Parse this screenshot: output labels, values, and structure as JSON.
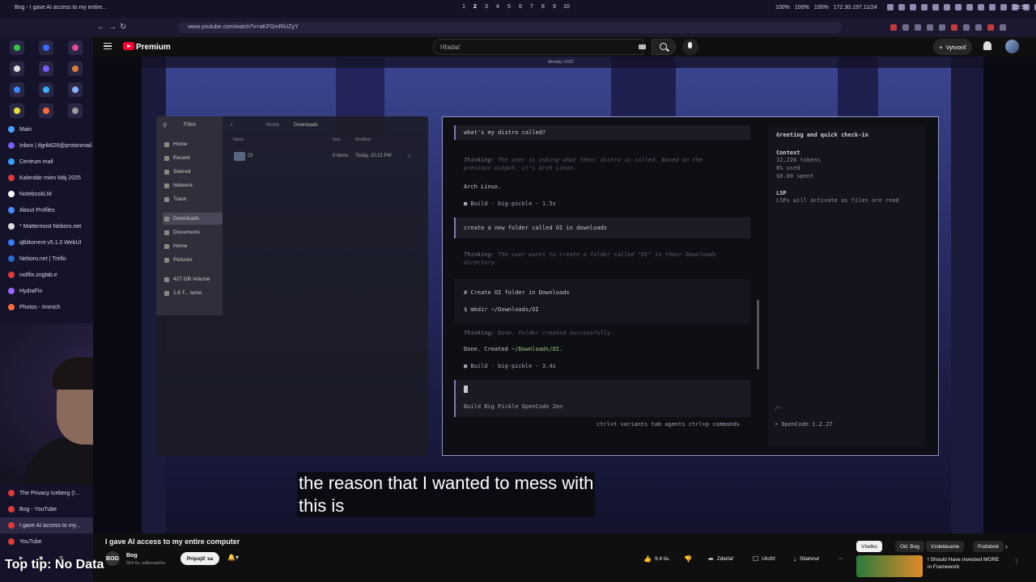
{
  "os": {
    "window_title": "Bog - I gave AI access to my entire...",
    "workspaces": [
      "1",
      "2",
      "3",
      "4",
      "5",
      "6",
      "7",
      "8",
      "9",
      "10"
    ],
    "active_workspace": "2",
    "stats": [
      "100%",
      "100%",
      "100%",
      "172.30.197.11/24"
    ],
    "clock": "23:58"
  },
  "browser": {
    "url": "www.youtube.com/watch?v=aKFGmRiUZyY"
  },
  "sidebar": {
    "items": [
      {
        "label": "Main",
        "color": "#4aa3ff"
      },
      {
        "label": "Inbox | tlgrik626@protonmail...",
        "color": "#7b5cff"
      },
      {
        "label": "Centrum mail",
        "color": "#3aa0ff"
      },
      {
        "label": "Kalendár mien Máj 2025",
        "color": "#e03a3a"
      },
      {
        "label": "NotebookLM",
        "color": "#ffffff"
      },
      {
        "label": "About Profiles",
        "color": "#4a8aff"
      },
      {
        "label": "* Mattermost Neboro.net",
        "color": "#dddddd"
      },
      {
        "label": "qBittorrent v5.1.0 WebUI",
        "color": "#3a7aff"
      },
      {
        "label": "Neboro.net | Trello",
        "color": "#2a6acc"
      },
      {
        "label": "notflix.zoglab.e",
        "color": "#e03a3a"
      },
      {
        "label": "HydraFin",
        "color": "#9a6aff"
      },
      {
        "label": "Photos - Immich",
        "color": "#ff6a3a"
      }
    ],
    "lower_items": [
      {
        "label": "The Privacy Iceberg (I...",
        "color": "#e03a3a"
      },
      {
        "label": "Bog - YouTube",
        "color": "#e03a3a"
      },
      {
        "label": "I gave AI access to my...",
        "color": "#e03a3a"
      },
      {
        "label": "YouTube",
        "color": "#e03a3a"
      }
    ]
  },
  "youtube": {
    "brand": "Premium",
    "search_placeholder": "Hľadať",
    "create_label": "Vytvoriť"
  },
  "video_overlay": {
    "topbar_clock": "Monday 22/22",
    "files": {
      "title": "Files",
      "breadcrumb": [
        "Home",
        "Downloads"
      ],
      "sidebar": [
        "Home",
        "Recent",
        "Starred",
        "Network",
        "Trash",
        "Downloads",
        "Documents",
        "Home",
        "Pictures",
        "427 GB Volume",
        "1.6 T... lume"
      ],
      "selected": "Downloads",
      "columns": [
        "Name",
        "Size",
        "Modified"
      ],
      "row": {
        "name": "OI",
        "size": "0 items",
        "modified": "Today, 10:21 PM"
      }
    },
    "terminal": {
      "q1": "what's my distro called?",
      "think1_label": "Thinking:",
      "think1": " The user is asking what their distro is called. Based on the",
      "think1b": "previous output, it's Arch Linux.",
      "a1": "Arch Linux.",
      "meta1": "■  Build · big-pickle · 1.5s",
      "q2": "create a new folder called OI in downloads",
      "think2_label": "Thinking:",
      "think2": " The user wants to create a folder called \"OI\" in their Downloads",
      "think2b": "directory.",
      "code1": "# Create OI folder in Downloads",
      "code2": "$ mkdir ~/Downloads/OI",
      "think3_label": "Thinking:",
      "think3": " Done. Folder created successfully.",
      "done_pre": "Done. Created ",
      "done_path": "~/Downloads/OI",
      "done_post": ".",
      "meta2": "■  Build · big-pickle · 3.4s",
      "input_status": "Build  Big Pickle OpenCode Zen",
      "hints": "ctrl+t variants  tab agents  ctrl+p commands",
      "side_title": "Greeting and quick check-in",
      "context_label": "Context",
      "context_tokens": "12,226 tokens",
      "context_used": "6% used",
      "context_spent": "$0.00 spent",
      "lsp_label": "LSP",
      "lsp_text": "LSPs will activate as files are read",
      "path": "/~",
      "version": "• OpenCode 1.2.27"
    },
    "subtitle_line1": "the reason that I wanted to mess with",
    "subtitle_line2": "this is"
  },
  "video_info": {
    "title": "I gave AI access to my entire computer",
    "channel": "Bog",
    "channel_initials": "BOG",
    "subs": "564 tis. odberateľov",
    "subscribe": "Pripojiť sa",
    "likes": "9,4 tis.",
    "share": "Zdieľať",
    "save": "Uložiť",
    "download": "Stiahnuť"
  },
  "chips": [
    "Všetko",
    "Od: Bog",
    "Vzdelávanie",
    "Podobné"
  ],
  "active_chip": "Všetko",
  "recommended": {
    "title": "I Should Have Invested MORE in Framework",
    "channel": "Framework"
  },
  "tip": "Top tip: No Data"
}
